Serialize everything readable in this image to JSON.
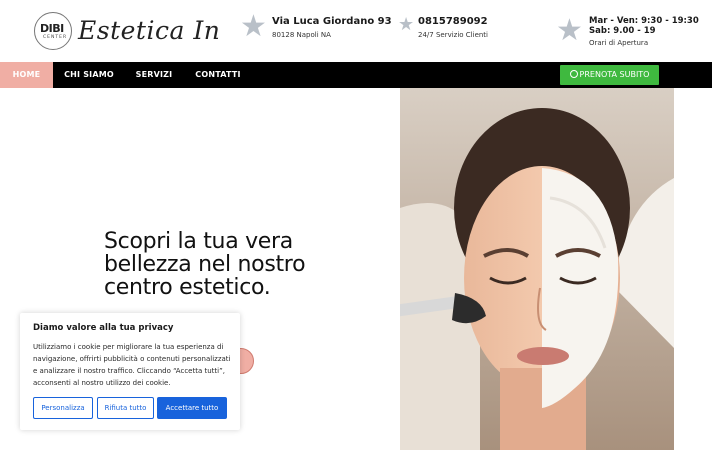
{
  "header": {
    "logo": {
      "mark_text": "DIBI",
      "mark_sub": "CENTER",
      "script_text": "Estetica In"
    },
    "address": {
      "line1": "Via Luca Giordano 93",
      "line2": "80128 Napoli NA"
    },
    "phone": {
      "line1": "0815789092",
      "line2": "24/7 Servizio Clienti"
    },
    "hours": {
      "line1": "Mar - Ven: 9:30 - 19:30",
      "line1b": "Sab: 9.00 - 19",
      "line2": "Orari di Apertura"
    }
  },
  "nav": {
    "items": [
      {
        "label": "HOME",
        "active": true
      },
      {
        "label": "CHI SIAMO",
        "active": false
      },
      {
        "label": "SERVIZI",
        "active": false
      },
      {
        "label": "CONTATTI",
        "active": false
      }
    ],
    "book_label": "PRENOTA SUBITO"
  },
  "hero": {
    "title": "Scopri la tua vera bellezza nel nostro centro estetico."
  },
  "cookie": {
    "title": "Diamo valore alla tua privacy",
    "text": "Utilizziamo i cookie per migliorare la tua esperienza di navigazione, offrirti pubblicità o contenuti personalizzati e analizzare il nostro traffico. Cliccando “Accetta tutti”, acconsenti al nostro utilizzo dei cookie.",
    "buttons": {
      "customize": "Personalizza",
      "reject": "Rifiuta tutto",
      "accept": "Accettare tutto"
    }
  },
  "colors": {
    "accent_pink": "#f0aea4",
    "nav_bg": "#000000",
    "book_green": "#3fb93f",
    "cookie_blue": "#1863dc",
    "star_grey": "#b9c0c8"
  },
  "icons": {
    "address": "star-icon",
    "phone": "star-icon",
    "hours": "star-icon",
    "book": "whatsapp-icon"
  }
}
